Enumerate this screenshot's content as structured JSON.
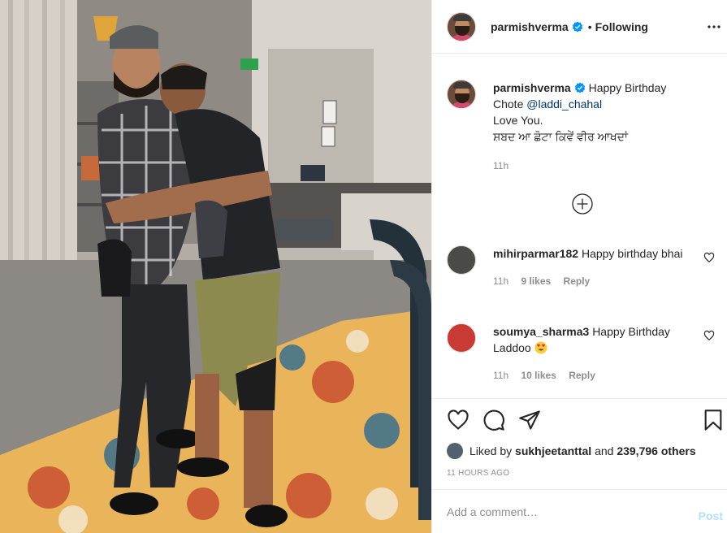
{
  "header": {
    "username": "parmishverma",
    "separator": "•",
    "follow_status": "Following"
  },
  "caption": {
    "username": "parmishverma",
    "text_1": "Happy Birthday",
    "text_2": "Chote",
    "mention": "@laddi_chahal",
    "text_3": "Love You.",
    "text_4": "ਸ਼ਬਦ ਆ ਛੋਟਾ ਕਿਵੇਂ ਵੀਰ ਆਖਦਾਂ",
    "time": "11h"
  },
  "comments": [
    {
      "username": "mihirparmar182",
      "text": "Happy birthday bhai",
      "time": "11h",
      "likes": "9 likes",
      "reply": "Reply"
    },
    {
      "username": "soumya_sharma3",
      "text": "Happy Birthday Laddoo",
      "emoji": "heart-eyes-emoji",
      "time": "11h",
      "likes": "10 likes",
      "reply": "Reply"
    }
  ],
  "likes": {
    "prefix": "Liked by",
    "user": "sukhjeetanttal",
    "middle": "and",
    "count": "239,796 others"
  },
  "timestamp": "11 HOURS AGO",
  "add_comment": {
    "placeholder": "Add a comment…",
    "post_label": "Post"
  },
  "icons": {
    "like": "heart-icon",
    "comment": "comment-icon",
    "share": "paper-plane-icon",
    "save": "bookmark-icon",
    "more": "more-options-icon",
    "load_more": "plus-circle-icon",
    "verified": "verified-badge-icon"
  },
  "colors": {
    "link": "#00376b",
    "secondary": "#8e8e8e",
    "post_disabled": "#b2dffc",
    "verified": "#0095f6"
  }
}
